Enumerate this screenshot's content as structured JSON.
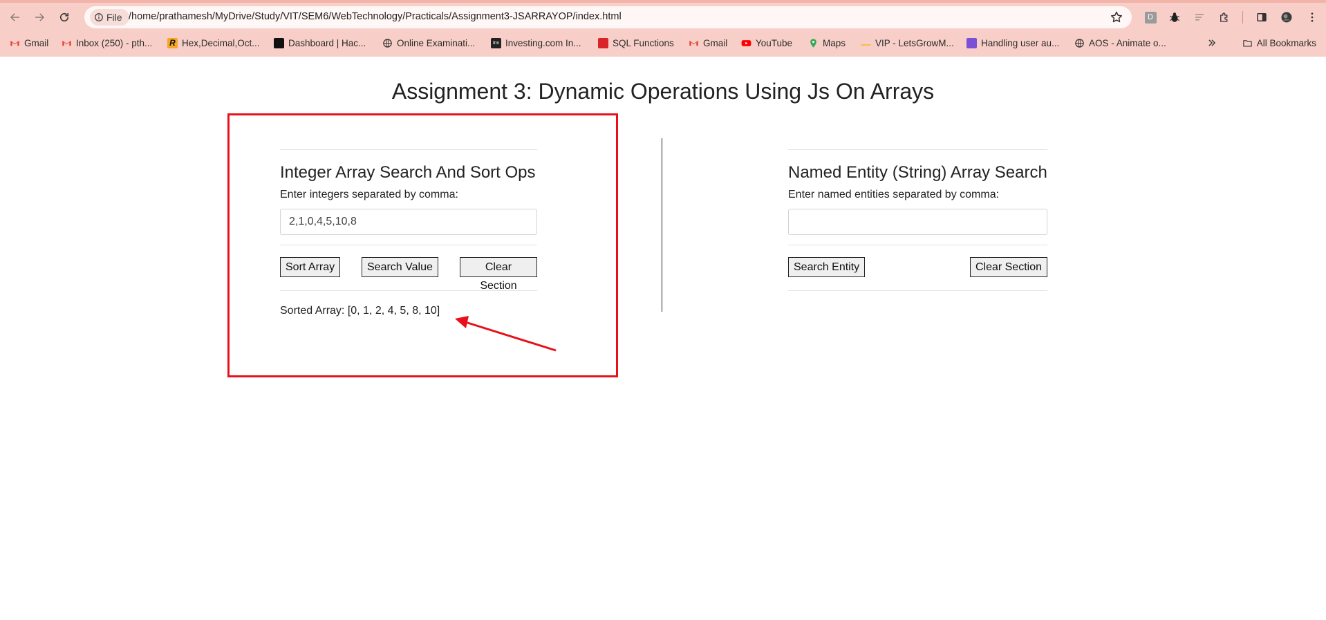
{
  "browser": {
    "file_chip_label": "File",
    "url": "/home/prathamesh/MyDrive/Study/VIT/SEM6/WebTechnology/Practicals/Assignment3-JSARRAYOP/index.html",
    "extensions": [
      "D"
    ],
    "bookmarks": [
      {
        "label": "Gmail",
        "color": "#ea4335"
      },
      {
        "label": "Inbox (250) - pth...",
        "color": "#ea4335"
      },
      {
        "label": "Hex,Decimal,Oct...",
        "color": "#f5a623",
        "glyph": "R"
      },
      {
        "label": "Dashboard | Hac...",
        "color": "#111111"
      },
      {
        "label": "Online Examinati...",
        "color": "#444444"
      },
      {
        "label": "Investing.com In...",
        "color": "#222222",
        "glyph": "Inv"
      },
      {
        "label": "SQL Functions",
        "color": "#d9252a"
      },
      {
        "label": "Gmail",
        "color": "#ea4335"
      },
      {
        "label": "YouTube",
        "color": "#ff0000"
      },
      {
        "label": "Maps",
        "color": "#34a853"
      },
      {
        "label": "VIP - LetsGrowM...",
        "color": "#f5c04a"
      },
      {
        "label": "Handling user au...",
        "color": "#7b4fd6"
      },
      {
        "label": "AOS - Animate o...",
        "color": "#444444"
      }
    ],
    "all_bookmarks_label": "All Bookmarks"
  },
  "page": {
    "title": "Assignment 3: Dynamic Operations Using Js On Arrays"
  },
  "integer_section": {
    "title": "Integer Array Search And Sort Ops",
    "label": "Enter integers separated by comma:",
    "input_value": "2,1,0,4,5,10,8",
    "buttons": {
      "sort": "Sort Array",
      "search": "Search Value",
      "clear": "Clear Section"
    },
    "result": "Sorted Array: [0, 1, 2, 4, 5, 8, 10]"
  },
  "string_section": {
    "title": "Named Entity (String) Array Search",
    "label": "Enter named entities separated by comma:",
    "input_value": "",
    "buttons": {
      "search": "Search Entity",
      "clear": "Clear Section"
    }
  },
  "colors": {
    "chrome_bg": "#f8cfc8",
    "annotation_red": "#e8101a"
  }
}
